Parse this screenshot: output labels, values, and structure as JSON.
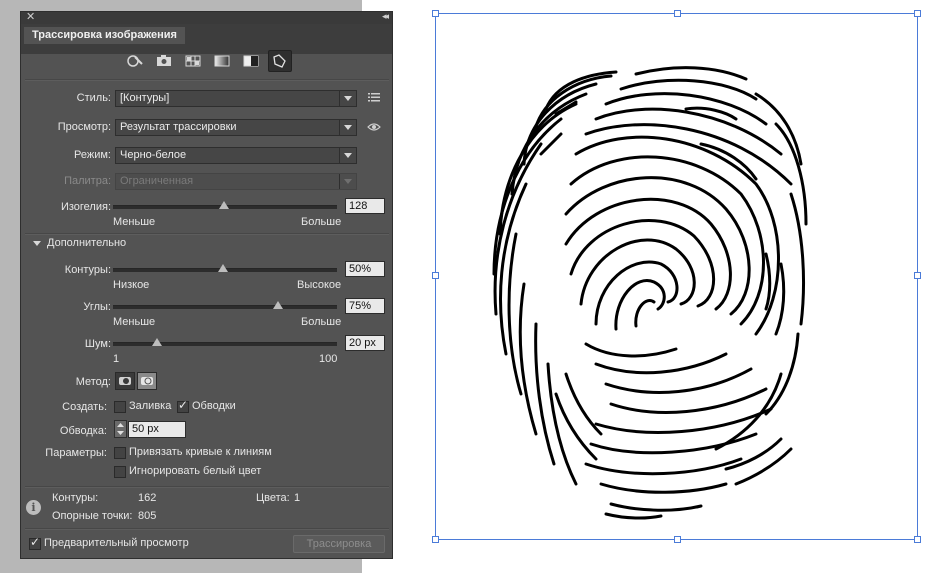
{
  "panel": {
    "tab_title": "Трассировка изображения",
    "close_symbol": "✕",
    "collapse_symbol": "◂◂",
    "presets": [
      {
        "name": "auto-color-preset-icon"
      },
      {
        "name": "high-color-photo-preset-icon"
      },
      {
        "name": "low-color-preset-icon"
      },
      {
        "name": "grayscale-preset-icon"
      },
      {
        "name": "black-white-preset-icon"
      },
      {
        "name": "outline-preset-icon"
      }
    ],
    "style": {
      "label": "Стиль:",
      "value": "[Контуры]"
    },
    "view": {
      "label": "Просмотр:",
      "value": "Результат трассировки"
    },
    "mode": {
      "label": "Режим:",
      "value": "Черно-белое"
    },
    "palette": {
      "label": "Палитра:",
      "value": "Ограниченная"
    },
    "threshold": {
      "label": "Изогелия:",
      "min_label": "Меньше",
      "max_label": "Больше",
      "value": "128",
      "level": 0.5
    },
    "advanced": {
      "label": "Дополнительно"
    },
    "paths": {
      "label": "Контуры:",
      "min_label": "Низкое",
      "max_label": "Высокое",
      "value": "50%",
      "level": 0.5
    },
    "corners": {
      "label": "Углы:",
      "min_label": "Меньше",
      "max_label": "Больше",
      "value": "75%",
      "level": 0.75
    },
    "noise": {
      "label": "Шум:",
      "min_label": "1",
      "max_label": "100",
      "value": "20 px",
      "level": 0.2
    },
    "method": {
      "label": "Метод:"
    },
    "create": {
      "label": "Создать:",
      "fill_label": "Заливка",
      "fill_checked": false,
      "stroke_label": "Обводки",
      "stroke_checked": true
    },
    "stroke": {
      "label": "Обводка:",
      "value": "50 px"
    },
    "options": {
      "label": "Параметры:",
      "snap_label": "Привязать кривые к линиям",
      "snap_checked": false,
      "ignore_white_label": "Игнорировать белый цвет",
      "ignore_white_checked": false
    },
    "stats": {
      "paths_label": "Контуры:",
      "paths_value": "162",
      "colors_label": "Цвета:",
      "colors_value": "1",
      "anchors_label": "Опорные точки:",
      "anchors_value": "805"
    },
    "preview": {
      "label": "Предварительный просмотр",
      "checked": true
    },
    "trace_button": "Трассировка"
  },
  "colors": {
    "panel_bg": "#535353",
    "selection": "#4b7bd8",
    "artwork": "#000000"
  }
}
